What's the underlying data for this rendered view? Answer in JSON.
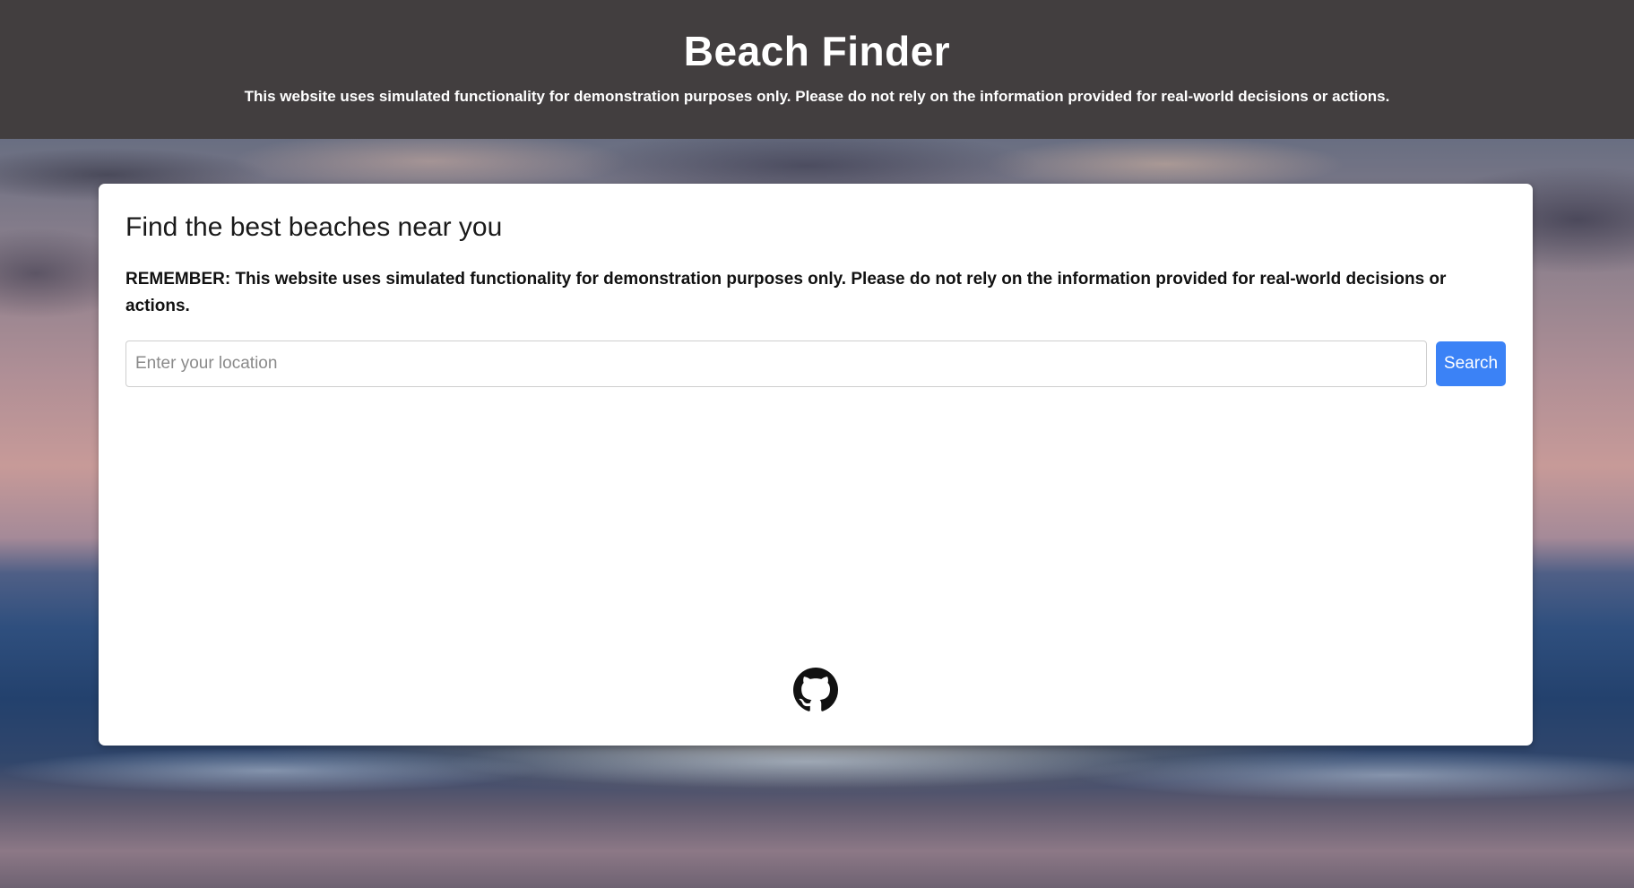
{
  "header": {
    "title": "Beach Finder",
    "disclaimer": "This website uses simulated functionality for demonstration purposes only. Please do not rely on the information provided for real-world decisions or actions."
  },
  "main": {
    "heading": "Find the best beaches near you",
    "reminder": "REMEMBER: This website uses simulated functionality for demonstration purposes only. Please do not rely on the information provided for real-world decisions or actions.",
    "search": {
      "placeholder": "Enter your location",
      "value": "",
      "button_label": "Search"
    }
  },
  "footer": {
    "icon": "github-icon"
  },
  "colors": {
    "header_bg": "#423e3f",
    "accent": "#3b82f6",
    "card_bg": "#ffffff"
  }
}
